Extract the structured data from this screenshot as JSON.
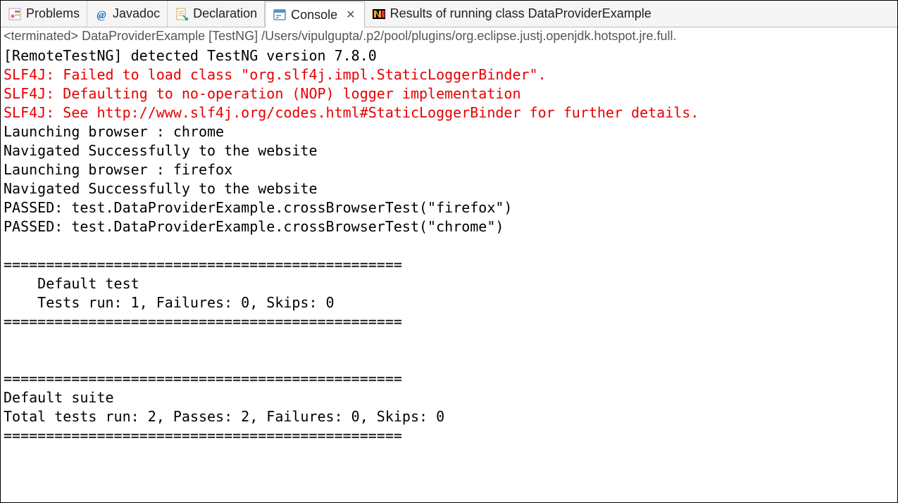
{
  "tabs": [
    {
      "label": "Problems",
      "icon": "problems-icon"
    },
    {
      "label": "Javadoc",
      "icon": "javadoc-icon"
    },
    {
      "label": "Declaration",
      "icon": "declaration-icon"
    },
    {
      "label": "Console",
      "icon": "console-icon",
      "active": true,
      "closable": true
    },
    {
      "label": "Results of running class DataProviderExample",
      "icon": "testng-icon"
    }
  ],
  "status": "<terminated> DataProviderExample [TestNG] /Users/vipulgupta/.p2/pool/plugins/org.eclipse.justj.openjdk.hotspot.jre.full.",
  "console_lines": [
    {
      "text": "[RemoteTestNG] detected TestNG version 7.8.0",
      "style": "out"
    },
    {
      "text": "SLF4J: Failed to load class \"org.slf4j.impl.StaticLoggerBinder\".",
      "style": "err"
    },
    {
      "text": "SLF4J: Defaulting to no-operation (NOP) logger implementation",
      "style": "err"
    },
    {
      "text": "SLF4J: See http://www.slf4j.org/codes.html#StaticLoggerBinder for further details.",
      "style": "err"
    },
    {
      "text": "Launching browser : chrome",
      "style": "out"
    },
    {
      "text": "Navigated Successfully to the website",
      "style": "out"
    },
    {
      "text": "Launching browser : firefox",
      "style": "out"
    },
    {
      "text": "Navigated Successfully to the website",
      "style": "out"
    },
    {
      "text": "PASSED: test.DataProviderExample.crossBrowserTest(\"firefox\")",
      "style": "out"
    },
    {
      "text": "PASSED: test.DataProviderExample.crossBrowserTest(\"chrome\")",
      "style": "out"
    },
    {
      "text": "",
      "style": "out"
    },
    {
      "text": "===============================================",
      "style": "out"
    },
    {
      "text": "    Default test",
      "style": "out"
    },
    {
      "text": "    Tests run: 1, Failures: 0, Skips: 0",
      "style": "out"
    },
    {
      "text": "===============================================",
      "style": "out"
    },
    {
      "text": "",
      "style": "out"
    },
    {
      "text": "",
      "style": "out"
    },
    {
      "text": "===============================================",
      "style": "out"
    },
    {
      "text": "Default suite",
      "style": "out"
    },
    {
      "text": "Total tests run: 2, Passes: 2, Failures: 0, Skips: 0",
      "style": "out"
    },
    {
      "text": "===============================================",
      "style": "out"
    }
  ]
}
